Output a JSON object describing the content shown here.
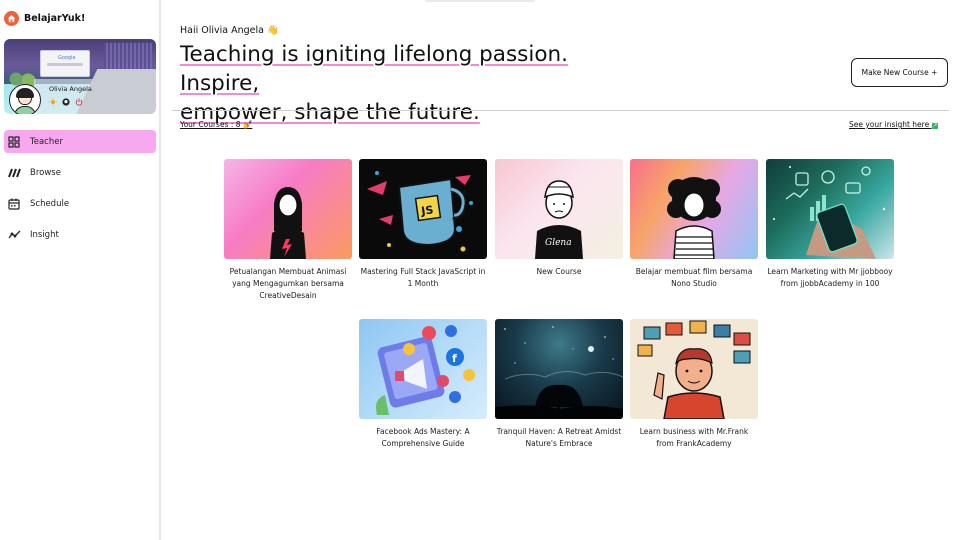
{
  "app": {
    "name": "BelajarYuk!"
  },
  "profile": {
    "name": "Olivia Angela",
    "screen_text": "Google"
  },
  "nav": [
    {
      "label": "Teacher",
      "icon": "dashboard-grid-icon",
      "active": true
    },
    {
      "label": "Browse",
      "icon": "browse-slashes-icon",
      "active": false
    },
    {
      "label": "Schedule",
      "icon": "calendar-icon",
      "active": false
    },
    {
      "label": "Insight",
      "icon": "trend-chart-icon",
      "active": false
    }
  ],
  "header": {
    "greeting": "Haii Olivia Angela",
    "greeting_emoji": "👋",
    "headline_line1": "Teaching is igniting lifelong passion. Inspire,",
    "headline_line2": "empower, shape the future.",
    "new_course_button": "Make New Course +"
  },
  "courses_bar": {
    "count_text": "Your Courses : 8",
    "count_emoji": "💅",
    "insight_text": "See your insight here",
    "insight_emoji": "📈"
  },
  "courses": [
    {
      "title": "Petualangan Membuat Animasi yang Mengagumkan bersama CreativeDesain"
    },
    {
      "title": "Mastering Full Stack JavaScript in 1 Month",
      "thumb_text": "JS"
    },
    {
      "title": "New Course",
      "thumb_text": "Glena"
    },
    {
      "title": "Belajar membuat film bersama Nono Studio"
    },
    {
      "title": "Learn Marketing with Mr jjobbooy from jjobbAcademy in 100"
    },
    {
      "title": "Facebook Ads Mastery: A Comprehensive Guide"
    },
    {
      "title": "Tranquil Haven: A Retreat Amidst Nature's Embrace"
    },
    {
      "title": "Learn business with Mr.Frank from FrankAcademy"
    }
  ],
  "colors": {
    "active_nav": "#f7a8ef",
    "brand": "#f2603a",
    "underline": "#f28ad8"
  }
}
